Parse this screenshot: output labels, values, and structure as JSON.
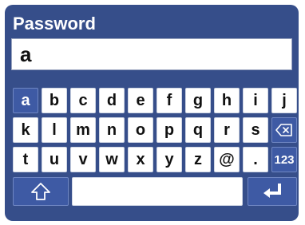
{
  "title": "Password",
  "input": {
    "value": "a"
  },
  "keyboard": {
    "rows": [
      [
        "a",
        "b",
        "c",
        "d",
        "e",
        "f",
        "g",
        "h",
        "i",
        "j"
      ],
      [
        "k",
        "l",
        "m",
        "n",
        "o",
        "p",
        "q",
        "r",
        "s"
      ],
      [
        "t",
        "u",
        "v",
        "w",
        "x",
        "y",
        "z",
        "@",
        "."
      ]
    ],
    "selected_key": "a",
    "mode_key_label": "123",
    "backspace_icon": "backspace-icon",
    "shift_icon": "shift-icon",
    "enter_icon": "enter-icon"
  },
  "colors": {
    "panel": "#364e8a",
    "selected_key": "#3e5aa4",
    "key": "#ffffff"
  }
}
